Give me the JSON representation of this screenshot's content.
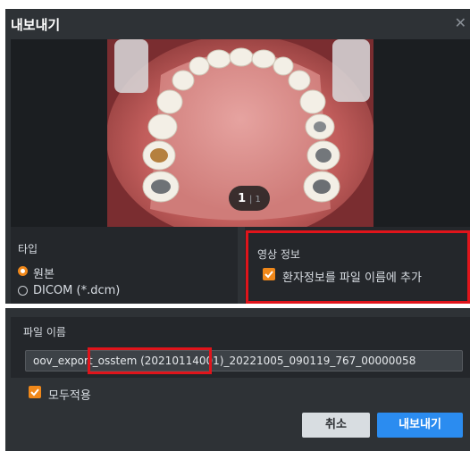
{
  "dialog": {
    "title": "내보내기"
  },
  "preview": {
    "page_current": "1",
    "page_total": "1"
  },
  "type_section": {
    "title": "타입",
    "options": [
      {
        "label": "원본",
        "selected": true
      },
      {
        "label": "DICOM (*.dcm)",
        "selected": false
      }
    ]
  },
  "image_info": {
    "title": "영상 정보",
    "checkbox_label": "환자정보를 파일 이름에 추가",
    "checked": true
  },
  "filename": {
    "title": "파일 이름",
    "prefix": "oov_export_",
    "patient": "osstem (20210114001)",
    "suffix": "_20221005_090119_767_00000058"
  },
  "apply_all": {
    "label": "모두적용",
    "checked": true
  },
  "buttons": {
    "cancel": "취소",
    "export": "내보내기"
  },
  "colors": {
    "accent": "#f0881a",
    "primary": "#2b8cf0",
    "highlight": "#e0141b"
  }
}
